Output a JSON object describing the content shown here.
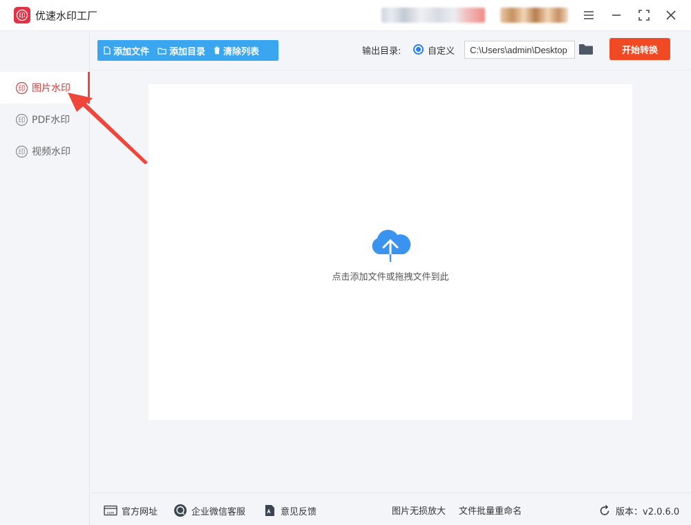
{
  "app": {
    "title": "优速水印工厂"
  },
  "sidebar": {
    "items": [
      {
        "label": "图片水印",
        "active": true
      },
      {
        "label": "PDF水印",
        "active": false
      },
      {
        "label": "视频水印",
        "active": false
      }
    ]
  },
  "toolbar": {
    "add_file": "添加文件",
    "add_dir": "添加目录",
    "clear_list": "清除列表",
    "output_label": "输出目录:",
    "output_option": "自定义",
    "output_path": "C:\\Users\\admin\\Desktop",
    "start": "开始转换"
  },
  "dropzone": {
    "hint": "点击添加文件或拖拽文件到此"
  },
  "footer": {
    "website": "官方网址",
    "wechat": "企业微信客服",
    "feedback": "意见反馈",
    "upscale": "图片无损放大",
    "rename": "文件批量重命名",
    "version": "版本：v2.0.6.0"
  },
  "colors": {
    "accent_blue": "#3aa6ef",
    "start_orange": "#f04a25",
    "active_red": "#d43a3a",
    "cloud_blue": "#3b93f0"
  }
}
